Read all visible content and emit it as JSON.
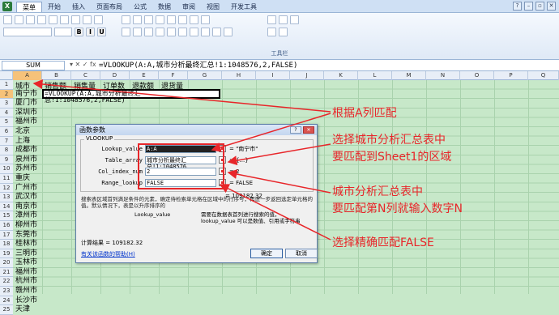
{
  "menubar": {
    "logo": "X",
    "items": [
      "菜单",
      "开始",
      "插入",
      "页面布局",
      "公式",
      "数据",
      "审阅",
      "视图",
      "开发工具"
    ],
    "active_index": 0
  },
  "ribbon": {
    "group_label": "工具栏"
  },
  "formula_bar": {
    "name_box": "SUM",
    "fx_buttons": "▾ ✕ ✓ fx",
    "formula": "=VLOOKUP(A:A,城市分析最终汇总!1:1048576,2,FALSE)"
  },
  "columns": [
    "A",
    "B",
    "C",
    "D",
    "E",
    "F",
    "G",
    "H",
    "I",
    "J",
    "K",
    "L",
    "M",
    "N",
    "O",
    "P",
    "Q"
  ],
  "selected_column": "A",
  "header_row": [
    "城市",
    "销售额",
    "销售量",
    "订单数",
    "退款额",
    "退货量"
  ],
  "cities": [
    "南宁市",
    "厦门市",
    "深圳市",
    "福州市",
    "北京",
    "上海",
    "成都市",
    "泉州市",
    "苏州市",
    "重庆",
    "广州市",
    "武汉市",
    "南京市",
    "漳州市",
    "柳州市",
    "东莞市",
    "桂林市",
    "三明市",
    "玉林市",
    "福州市",
    "杭州市",
    "赣州市",
    "长沙市",
    "天津"
  ],
  "rows": [
    "1",
    "2",
    "3",
    "4",
    "5",
    "6",
    "7",
    "8",
    "9",
    "10",
    "11",
    "12",
    "13",
    "14",
    "15",
    "16",
    "17",
    "18",
    "19",
    "20",
    "21",
    "22",
    "23",
    "24",
    "25"
  ],
  "selected_row": "2",
  "active_cell_text": "=VLOOKUP(A:A,城市分析最终汇总!1:1048576,2,FALSE)",
  "dialog": {
    "title": "函数参数",
    "function_name": "VLOOKUP",
    "args": [
      {
        "label": "Lookup_value",
        "input": "A:A",
        "value": "= \"南宁市\""
      },
      {
        "label": "Table_array",
        "input": "城市分析最终汇总!1:1048576",
        "value": "= {...}"
      },
      {
        "label": "Col_index_num",
        "input": "2",
        "value": "= 2"
      },
      {
        "label": "Range_lookup",
        "input": "FALSE",
        "value": "= FALSE"
      }
    ],
    "result_inline": "= 109182.32",
    "description": "搜索表区域首列满足条件的元素，确定待检索单元格在区域中的行序号，再进一步返回选定单元格的值。默认情况下，表是以升序排序的",
    "param_name": "Lookup_value",
    "param_desc": "需要在数据表首列进行搜索的值，lookup_value 可以是数值、引用或字符串",
    "result": "计算结果 = 109182.32",
    "help_link": "有关该函数的帮助(H)",
    "ok": "确定",
    "cancel": "取消",
    "title_buttons": [
      "?",
      "✕"
    ]
  },
  "annotations": {
    "a1": "根据A列匹配",
    "a2_line1": "选择城市分析汇总表中",
    "a2_line2": "要匹配到Sheet1的区域",
    "a3_line1": "城市分析汇总表中",
    "a3_line2": "要匹配第N列就输入数字N",
    "a4": "选择精确匹配FALSE"
  },
  "colors": {
    "annotation": "#e8262a",
    "sheet_bg": "#c7e8c9",
    "selected_header": "#f6c27a"
  }
}
